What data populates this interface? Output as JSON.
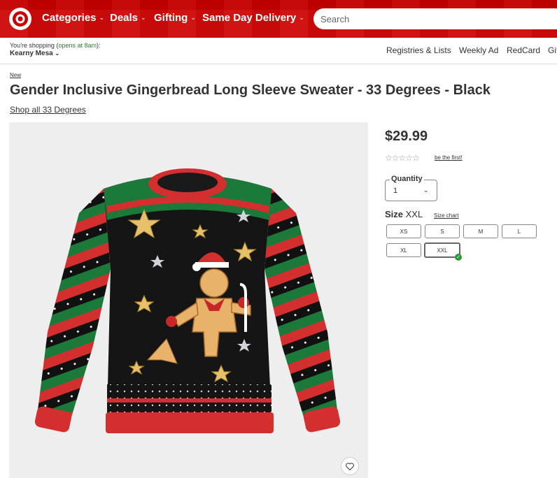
{
  "header": {
    "nav": [
      {
        "label": "Categories"
      },
      {
        "label": "Deals"
      },
      {
        "label": "Gifting"
      },
      {
        "label": "Same Day Delivery"
      }
    ],
    "search_placeholder": "Search"
  },
  "store": {
    "line1_prefix": "You're shopping (",
    "open_text": "opens at 8am",
    "line1_suffix": "):",
    "name": "Kearny Mesa"
  },
  "sublinks": [
    "Registries & Lists",
    "Weekly Ad",
    "RedCard",
    "Gift"
  ],
  "product": {
    "badge": "New",
    "title": "Gender Inclusive Gingerbread Long Sleeve Sweater - 33 Degrees - Black",
    "shop_all": "Shop all 33 Degrees",
    "price": "$29.99",
    "rating_stars": "☆☆☆☆☆",
    "rating_cta": "be the first!",
    "quantity_label": "Quantity",
    "quantity_value": "1",
    "size_label": "Size",
    "size_selected": "XXL",
    "size_chart": "Size chart",
    "sizes": [
      "XS",
      "S",
      "M",
      "L",
      "XL",
      "XXL"
    ]
  },
  "colors": {
    "brand_red": "#cc0000",
    "in_stock_green": "#2e9b3a"
  }
}
